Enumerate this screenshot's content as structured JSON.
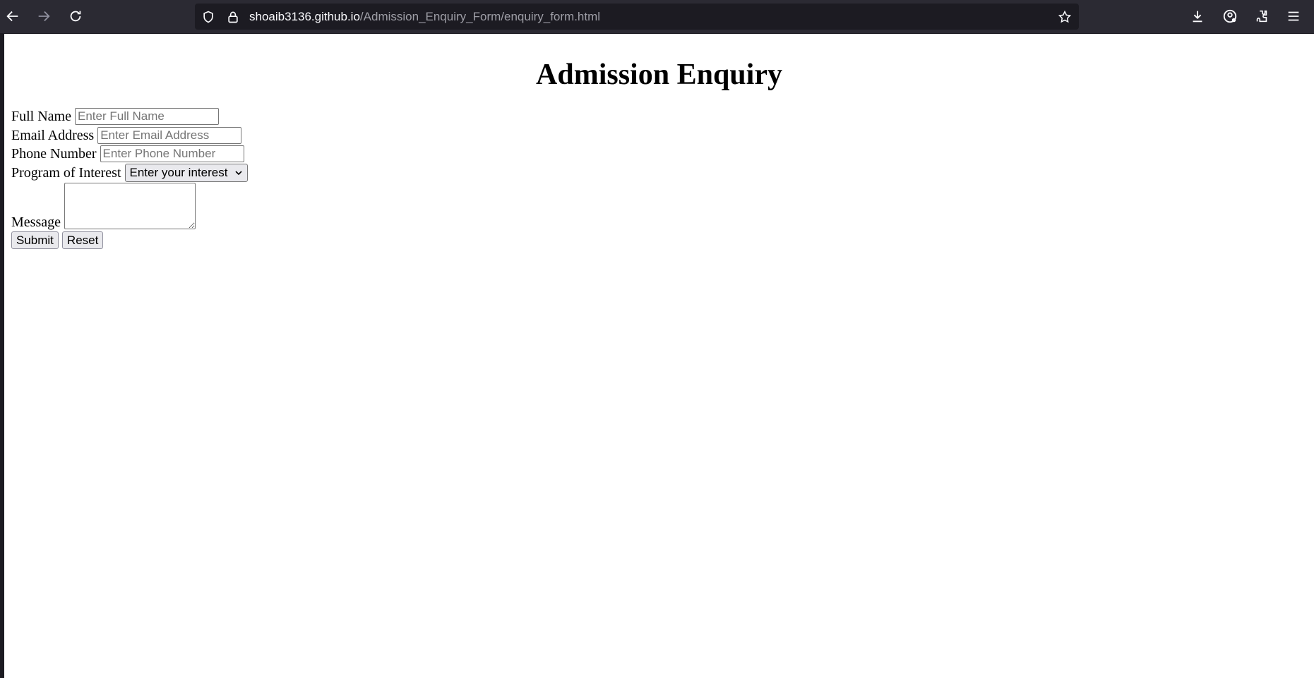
{
  "browser": {
    "url_host": "shoaib3136.github.io",
    "url_path": "/Admission_Enquiry_Form/enquiry_form.html",
    "icons": [
      "back-arrow-icon",
      "forward-arrow-icon",
      "reload-icon",
      "shield-icon",
      "lock-icon",
      "bookmark-star-icon",
      "download-icon",
      "account-icon",
      "extensions-icon",
      "menu-icon"
    ]
  },
  "page": {
    "title": "Admission Enquiry",
    "fields": {
      "full_name": {
        "label": "Full Name",
        "placeholder": "Enter Full Name",
        "value": ""
      },
      "email": {
        "label": "Email Address",
        "placeholder": "Enter Email Address",
        "value": ""
      },
      "phone": {
        "label": "Phone Number",
        "placeholder": "Enter Phone Number",
        "value": ""
      },
      "program": {
        "label": "Program of Interest",
        "selected": "Enter your interest"
      },
      "message": {
        "label": "Message",
        "value": ""
      }
    },
    "buttons": {
      "submit": "Submit",
      "reset": "Reset"
    }
  },
  "colors": {
    "toolbar_bg": "#2b2a33",
    "urlbar_bg": "#1c1b22",
    "page_bg": "#ffffff"
  }
}
